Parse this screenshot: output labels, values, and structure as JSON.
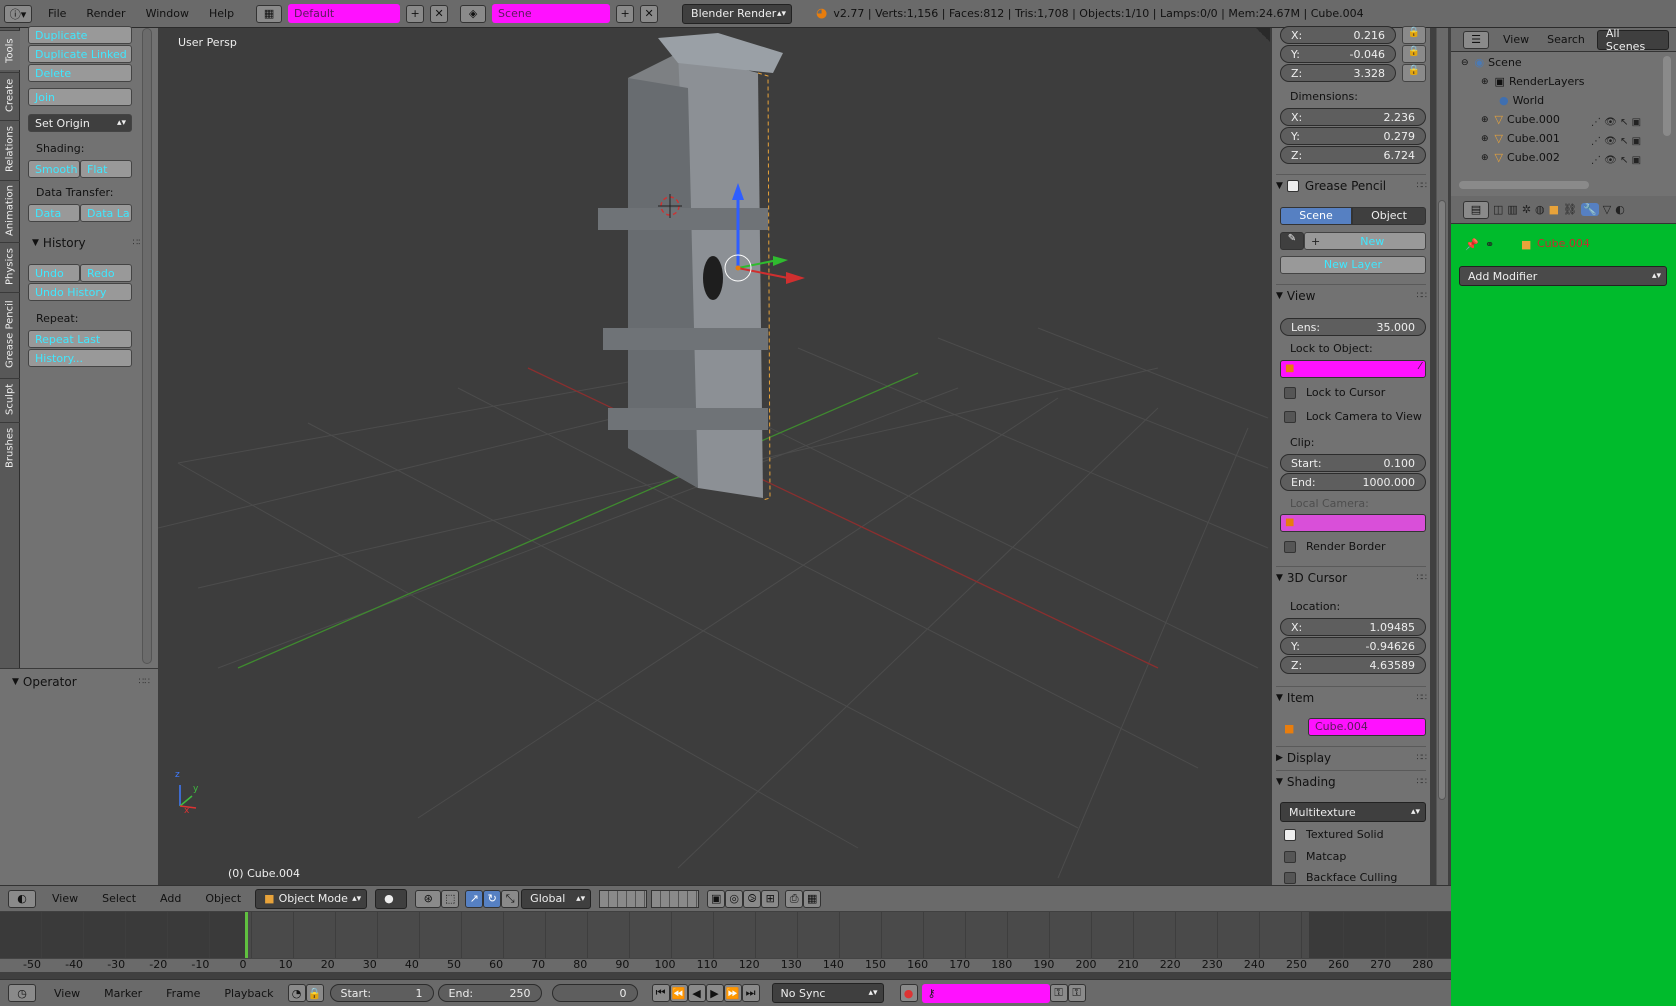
{
  "topbar": {
    "menus": [
      "File",
      "Render",
      "Window",
      "Help"
    ],
    "layout": "Default",
    "scene": "Scene",
    "engine": "Blender Render",
    "stats": "v2.77 | Verts:1,156 | Faces:812 | Tris:1,708 | Objects:1/10 | Lamps:0/0 | Mem:24.67M | Cube.004"
  },
  "side_tabs": [
    "Tools",
    "Create",
    "Relations",
    "Animation",
    "Physics",
    "Grease Pencil",
    "Sculpt",
    "Brushes"
  ],
  "tools": {
    "btn_duplicate": "Duplicate",
    "btn_duplicate_linked": "Duplicate Linked",
    "btn_delete": "Delete",
    "btn_join": "Join",
    "set_origin": "Set Origin",
    "shading_label": "Shading:",
    "btn_smooth": "Smooth",
    "btn_flat": "Flat",
    "data_transfer_label": "Data Transfer:",
    "btn_data": "Data",
    "btn_data_la": "Data La",
    "history_title": "History",
    "btn_undo": "Undo",
    "btn_redo": "Redo",
    "btn_undo_history": "Undo History",
    "repeat_label": "Repeat:",
    "btn_repeat_last": "Repeat Last",
    "btn_history": "History..."
  },
  "operator": {
    "title": "Operator"
  },
  "viewport": {
    "label": "User Persp",
    "object_label": "(0) Cube.004",
    "axis_z": "z",
    "axis_y": "y",
    "axis_x": "x"
  },
  "properties": {
    "loc_x": "0.216",
    "loc_y": "-0.046",
    "loc_z": "3.328",
    "dimensions_label": "Dimensions:",
    "dim_x": "2.236",
    "dim_y": "0.279",
    "dim_z": "6.724",
    "grease_pencil_title": "Grease Pencil",
    "gp_scene": "Scene",
    "gp_object": "Object",
    "gp_new": "New",
    "gp_new_layer": "New Layer",
    "view_title": "View",
    "lens_label": "Lens:",
    "lens_value": "35.000",
    "lock_to_object_label": "Lock to Object:",
    "lock_to_cursor": "Lock to Cursor",
    "lock_camera_to_view": "Lock Camera to View",
    "clip_label": "Clip:",
    "clip_start_label": "Start:",
    "clip_start": "0.100",
    "clip_end_label": "End:",
    "clip_end": "1000.000",
    "local_camera_label": "Local Camera:",
    "render_border": "Render Border",
    "cursor_title": "3D Cursor",
    "location_label": "Location:",
    "cursor_x": "1.09485",
    "cursor_y": "-0.94626",
    "cursor_z": "4.63589",
    "item_title": "Item",
    "item_name": "Cube.004",
    "display_title": "Display",
    "shading_title": "Shading",
    "shading_mode": "Multitexture",
    "textured_solid": "Textured Solid",
    "matcap": "Matcap",
    "backface_culling": "Backface Culling",
    "x": "X:",
    "y": "Y:",
    "z": "Z:"
  },
  "outliner": {
    "view": "View",
    "search": "Search",
    "all_scenes": "All Scenes",
    "items": [
      "Scene",
      "RenderLayers",
      "World",
      "Cube.000",
      "Cube.001",
      "Cube.002"
    ]
  },
  "modifiers": {
    "object_name": "Cube.004",
    "add_modifier": "Add Modifier"
  },
  "view3d_header": {
    "menus": [
      "View",
      "Select",
      "Add",
      "Object"
    ],
    "mode": "Object Mode",
    "orientation": "Global"
  },
  "timeline": {
    "ticks": [
      "-50",
      "-40",
      "-30",
      "-20",
      "-10",
      "0",
      "10",
      "20",
      "30",
      "40",
      "50",
      "60",
      "70",
      "80",
      "90",
      "100",
      "110",
      "120",
      "130",
      "140",
      "150",
      "160",
      "170",
      "180",
      "190",
      "200",
      "210",
      "220",
      "230",
      "240",
      "250",
      "260",
      "270",
      "280"
    ],
    "menus": [
      "View",
      "Marker",
      "Frame",
      "Playback"
    ],
    "start_label": "Start:",
    "start": "1",
    "end_label": "End:",
    "end": "250",
    "current": "0",
    "sync": "No Sync"
  }
}
